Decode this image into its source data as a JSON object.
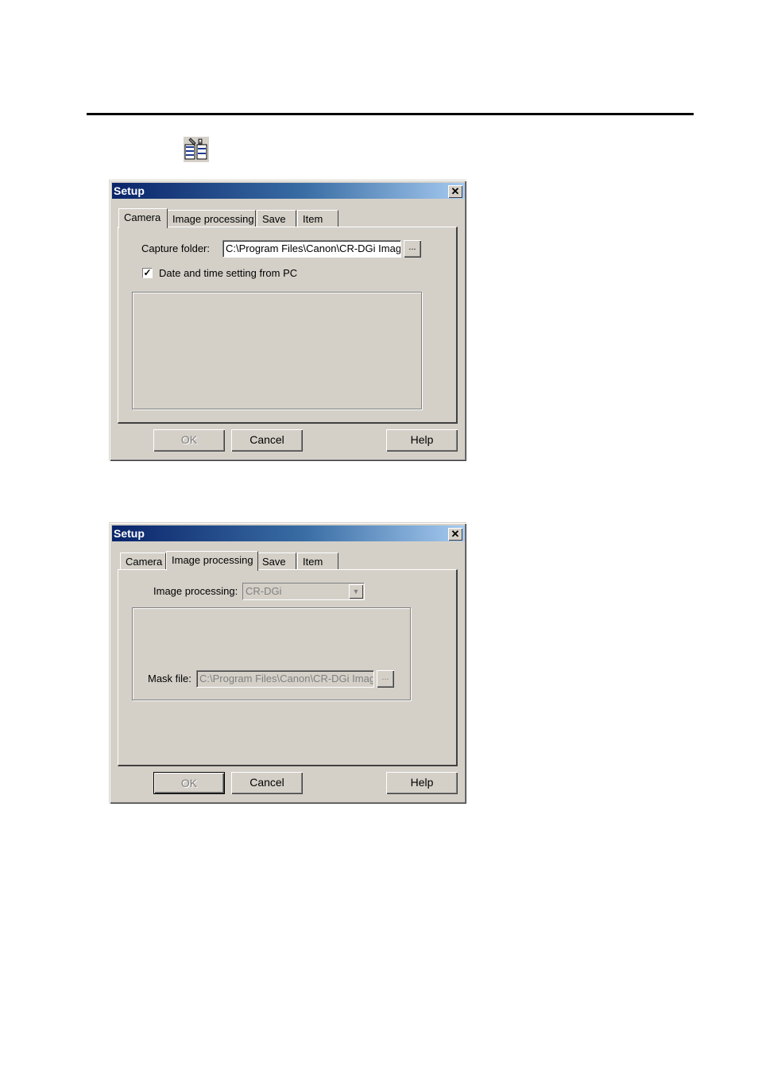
{
  "toolbar": {
    "icon": "setup-tool-icon"
  },
  "dialogs": [
    {
      "title": "Setup",
      "close": "✕",
      "tabs": [
        "Camera",
        "Image processing",
        "Save",
        "Item"
      ],
      "active_tab": "Camera",
      "capture_folder_label": "Capture folder:",
      "capture_folder_value": "C:\\Program Files\\Canon\\CR-DGi Imag",
      "browse_label": "...",
      "checkbox_label": "Date and time setting from PC",
      "checkbox_checked": true,
      "checkbox_mark": "✓",
      "buttons": {
        "ok": "OK",
        "cancel": "Cancel",
        "help": "Help"
      }
    },
    {
      "title": "Setup",
      "close": "✕",
      "tabs": [
        "Camera",
        "Image processing",
        "Save",
        "Item"
      ],
      "active_tab": "Image processing",
      "image_processing_label": "Image processing:",
      "image_processing_value": "CR-DGi",
      "combo_arrow": "▼",
      "mask_file_label": "Mask file:",
      "mask_file_value": "C:\\Program Files\\Canon\\CR-DGi Imag",
      "browse_label": "...",
      "buttons": {
        "ok": "OK",
        "cancel": "Cancel",
        "help": "Help"
      }
    }
  ]
}
